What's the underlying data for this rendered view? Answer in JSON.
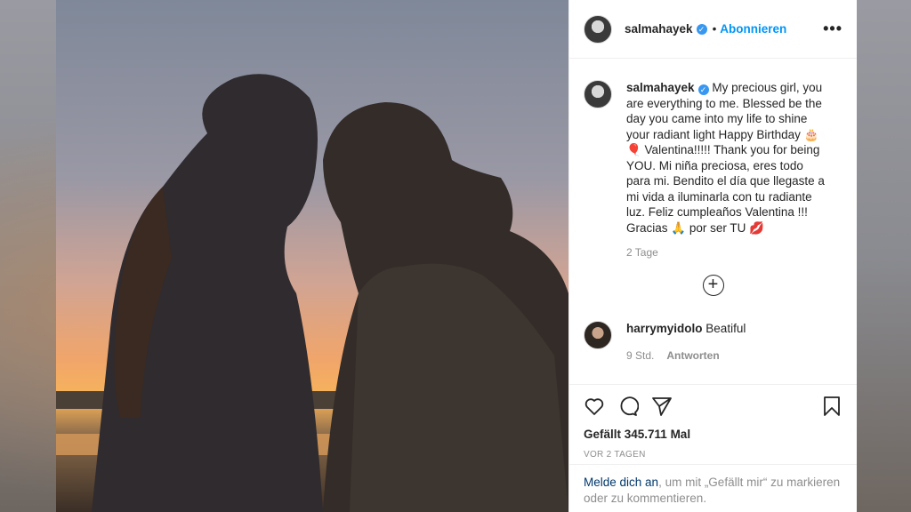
{
  "post": {
    "username": "salmahayek",
    "verified": true,
    "separator": "•",
    "follow_label": "Abonnieren",
    "more_label": "•••",
    "caption": "My precious girl, you are everything to me. Blessed be the day you came into my life to shine your radiant light Happy Birthday 🎂🎈 Valentina!!!!! Thank you for being YOU. Mi niña preciosa, eres todo para mi. Bendito el día que llegaste a mi vida a iluminarla con tu radiante luz. Feliz cumpleaños Valentina !!! Gracias 🙏 por ser TU 💋",
    "caption_age": "2 Tage",
    "add_comment_label": "+"
  },
  "comments": [
    {
      "username": "harrymyidolo",
      "text": "Beatiful",
      "age": "9 Std.",
      "reply_label": "Antworten"
    }
  ],
  "engagement": {
    "likes_text": "Gefällt 345.711 Mal",
    "date_text": "VOR 2 TAGEN"
  },
  "login_prompt": {
    "link_text": "Melde dich an",
    "rest_text": ", um mit „Gefällt mir“ zu markieren oder zu kommentieren."
  },
  "icons": {
    "like": "heart-icon",
    "comment": "comment-icon",
    "share": "paper-plane-icon",
    "save": "bookmark-icon"
  },
  "colors": {
    "link_blue": "#0095f6",
    "verified_blue": "#3897f0",
    "text": "#262626",
    "muted": "#8e8e8e"
  }
}
